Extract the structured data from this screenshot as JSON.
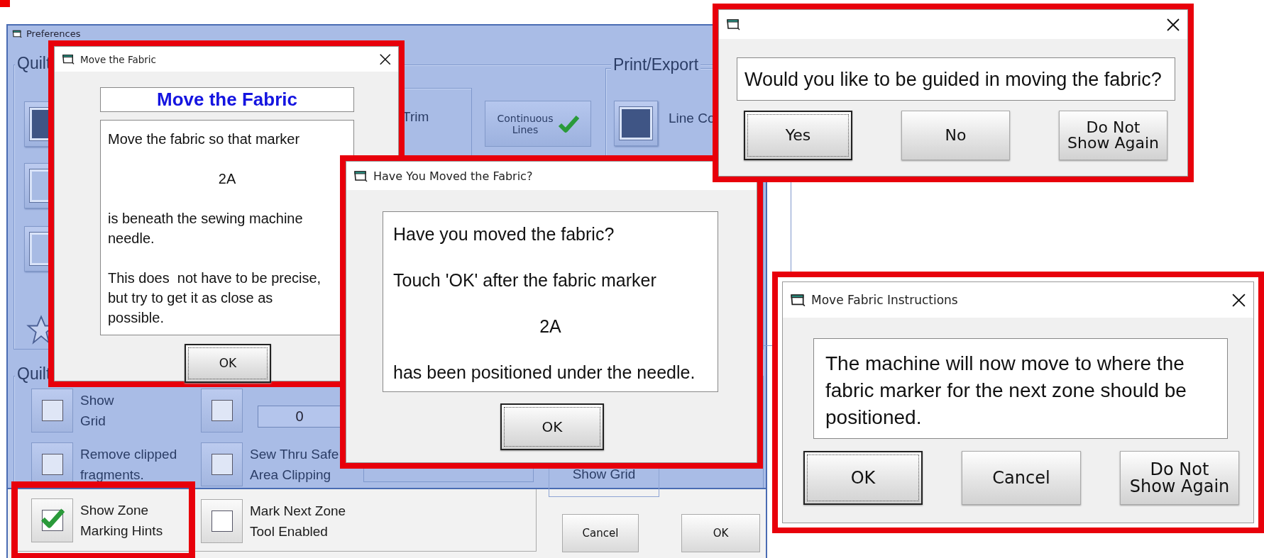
{
  "preferences": {
    "title": "Preferences",
    "quilt_group_label": "Quilt",
    "swatches": [
      {
        "color": "#3f5585"
      },
      {
        "color": "#a8bbe4"
      },
      {
        "color": "#a8bbe4"
      }
    ],
    "trim_label": "Trim",
    "continuous_lines": {
      "label": "Continuous\nLines",
      "checked": true
    },
    "print_export_label": "Print/Export",
    "line_color_swatch": {
      "color": "#3f5585"
    },
    "line_color_label": "Line Co",
    "quilt_group_2_label": "Quilt",
    "options": [
      {
        "label": "Show\nGrid",
        "checked": false,
        "highlighted": false
      },
      {
        "checked": false,
        "highlighted": false
      },
      {
        "label": "Remove clipped\nfragments.",
        "checked": false,
        "highlighted": false
      },
      {
        "label": "Sew Thru Safe\nArea Clipping",
        "checked": false,
        "highlighted": false
      },
      {
        "label": "Show Zone\nMarking Hints",
        "checked": true,
        "highlighted": true
      },
      {
        "label": "Mark Next Zone\nTool Enabled",
        "checked": false,
        "highlighted": false
      }
    ],
    "offset_field": {
      "value": "0"
    },
    "grid_button": {
      "label": "Show Grid"
    },
    "buttons": [
      "Cancel",
      "OK"
    ]
  },
  "dialogs": [
    {
      "title": "Move the Fabric",
      "highlighted": true,
      "heading": "Move the Fabric",
      "paragraphs": [
        {
          "kind": "plain",
          "text": "Move the fabric so that marker"
        },
        {
          "kind": "centered",
          "text": "2A"
        },
        {
          "kind": "plain",
          "text": "is beneath the sewing machine\nneedle."
        },
        {
          "kind": "plain",
          "text": "This does  not have to be precise,\nbut try to get it as close as\npossible."
        }
      ],
      "buttons": [
        {
          "label": "OK",
          "focused": true
        }
      ]
    },
    {
      "title": "Have You Moved the Fabric?",
      "highlighted": true,
      "paragraphs": [
        {
          "kind": "plain",
          "text": "Have you moved the fabric?"
        },
        {
          "kind": "plain",
          "text": "Touch 'OK' after the fabric marker"
        },
        {
          "kind": "centered",
          "text": "2A"
        },
        {
          "kind": "plain",
          "text": "has been positioned under the needle."
        }
      ],
      "buttons": [
        {
          "label": "OK",
          "focused": true
        }
      ]
    },
    {
      "highlighted": true,
      "paragraphs": [
        {
          "kind": "plain",
          "text": "Would you like to be guided in moving the fabric?"
        }
      ],
      "buttons": [
        {
          "label": "Yes",
          "focused": true
        },
        {
          "label": "No",
          "focused": false
        },
        {
          "label": "Do Not\nShow Again",
          "focused": false
        }
      ]
    },
    {
      "title": "Move Fabric Instructions",
      "highlighted": true,
      "paragraphs": [
        {
          "kind": "plain",
          "text": "The machine will now move to where the\nfabric marker for the next zone should be\npositioned."
        }
      ],
      "buttons": [
        {
          "label": "OK",
          "focused": true
        },
        {
          "label": "Cancel",
          "focused": false
        },
        {
          "label": "Do Not\nShow Again",
          "focused": false
        }
      ]
    }
  ]
}
